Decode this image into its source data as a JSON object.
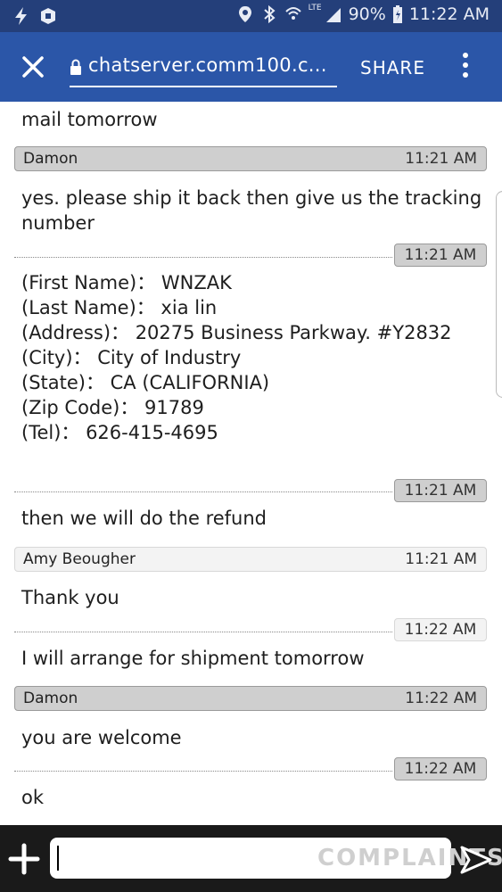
{
  "statusbar": {
    "icons_left": [
      "flash-icon",
      "shield-app-icon"
    ],
    "icons_right": [
      "location-icon",
      "bluetooth-icon",
      "wifi-icon",
      "signal-icon",
      "battery-icon"
    ],
    "network": "LTE",
    "battery": "90%",
    "time": "11:22 AM"
  },
  "toolbar": {
    "url": "chatserver.comm100.c...",
    "share_label": "SHARE"
  },
  "chat": {
    "top_partial": "mail tomorrow",
    "messages": [
      {
        "sender": "Damon",
        "time": "11:21 AM",
        "text_lines": [
          "yes. please ship it back then give us the tracking",
          "number"
        ]
      },
      {
        "time": "11:21 AM",
        "text_lines": [
          "(First Name)：  WNZAK",
          "(Last Name)：  xia lin",
          "(Address)：  20275 Business Parkway. #Y2832",
          "(City)：  City of Industry",
          "(State)：  CA (CALIFORNIA)",
          "(Zip Code)：  91789",
          "(Tel)：  626-415-4695"
        ]
      },
      {
        "time": "11:21 AM",
        "text_lines": [
          "then we will do the refund"
        ]
      },
      {
        "sender": "Amy Beougher",
        "time": "11:21 AM",
        "text_lines": [
          "Thank you"
        ]
      },
      {
        "time": "11:22 AM",
        "text_lines": [
          "I will arrange for shipment tomorrow"
        ]
      },
      {
        "sender": "Damon",
        "time": "11:22 AM",
        "text_lines": [
          "you are welcome"
        ]
      },
      {
        "time": "11:22 AM",
        "text_lines": [
          "ok"
        ]
      }
    ]
  },
  "composer": {
    "input_value": "",
    "watermark": "COMPLAINTS"
  },
  "colors": {
    "statusbar_bg": "#243f7a",
    "toolbar_bg": "#2b56a8",
    "agent_bar_bg": "#cfcfcf",
    "visitor_bar_bg": "#f3f3f3",
    "composer_bg": "#1a1a1a"
  }
}
